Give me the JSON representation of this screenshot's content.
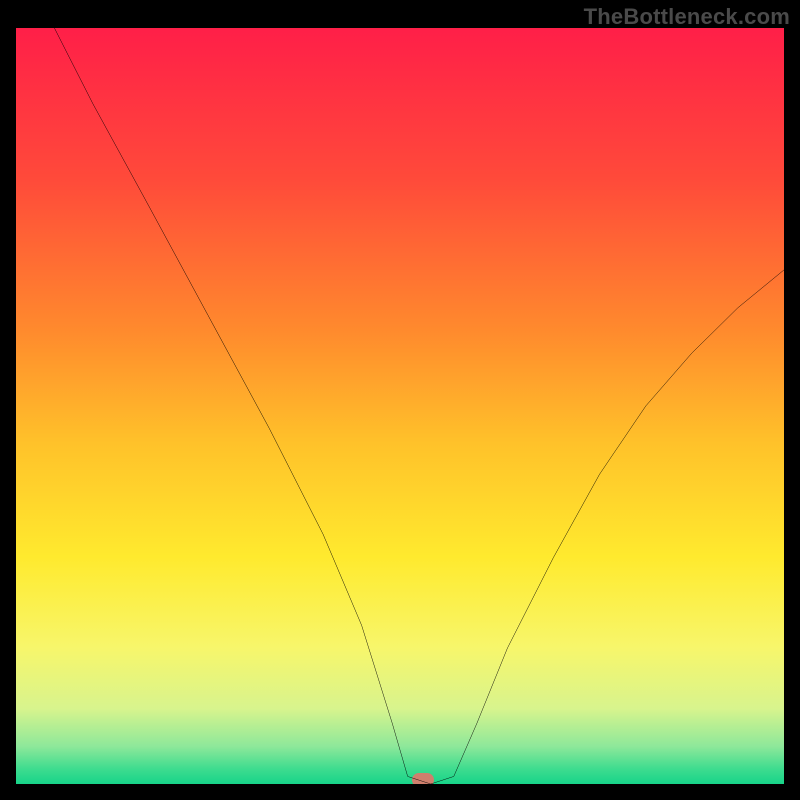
{
  "watermark": "TheBottleneck.com",
  "chart_data": {
    "type": "line",
    "title": "",
    "xlabel": "",
    "ylabel": "",
    "xlim": [
      0,
      100
    ],
    "ylim": [
      0,
      100
    ],
    "series": [
      {
        "name": "curve",
        "x": [
          5,
          10,
          17,
          25,
          33,
          40,
          45,
          49,
          51,
          54,
          57,
          60,
          64,
          70,
          76,
          82,
          88,
          94,
          100
        ],
        "y": [
          100,
          90,
          77,
          62,
          47,
          33,
          21,
          8,
          1,
          0,
          1,
          8,
          18,
          30,
          41,
          50,
          57,
          63,
          68
        ]
      }
    ],
    "marker": {
      "x": 53,
      "y": 0.5
    },
    "background_gradient_stops": [
      {
        "pct": 0,
        "color": "#ff1f48"
      },
      {
        "pct": 20,
        "color": "#ff4a3a"
      },
      {
        "pct": 40,
        "color": "#ff8a2d"
      },
      {
        "pct": 55,
        "color": "#ffc22a"
      },
      {
        "pct": 70,
        "color": "#ffea2e"
      },
      {
        "pct": 82,
        "color": "#f7f66b"
      },
      {
        "pct": 90,
        "color": "#d8f48d"
      },
      {
        "pct": 95,
        "color": "#8ee89a"
      },
      {
        "pct": 98,
        "color": "#3edc8f"
      },
      {
        "pct": 100,
        "color": "#17d489"
      }
    ]
  }
}
